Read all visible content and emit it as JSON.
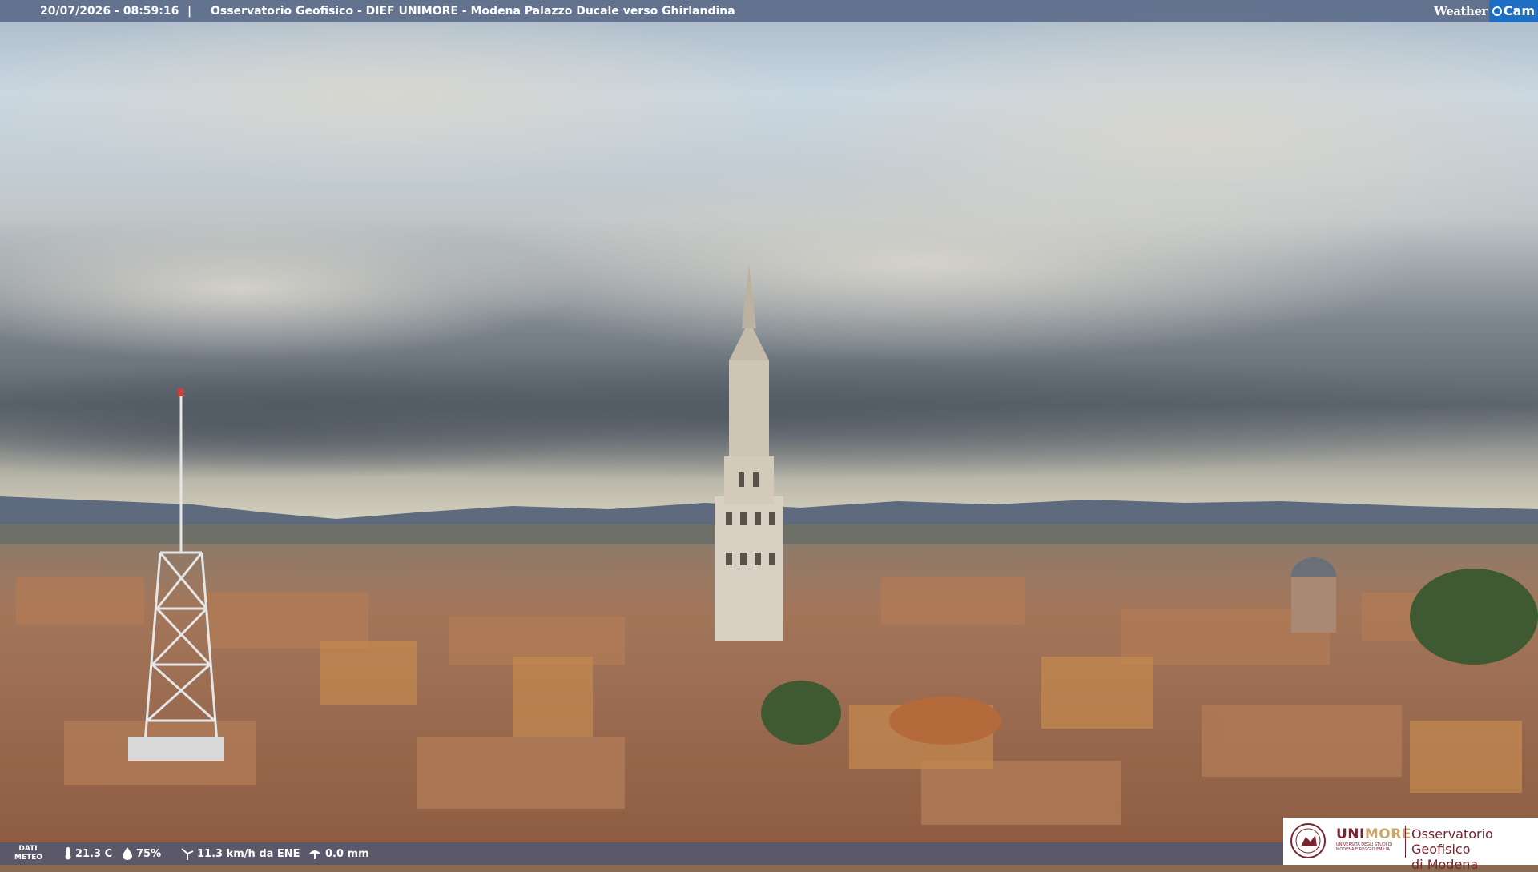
{
  "header": {
    "datetime": "20/07/2026 - 08:59:16",
    "separator": "|",
    "location": "Osservatorio Geofisico - DIEF UNIMORE - Modena Palazzo Ducale verso Ghirlandina",
    "brand_weather": "Weather",
    "brand_cam": "Cam"
  },
  "weather": {
    "label_line1": "DATI",
    "label_line2": "METEO",
    "temperature": "21.3 C",
    "humidity": "75%",
    "wind": "11.3 km/h da ENE",
    "rain": "0.0 mm"
  },
  "logo": {
    "uni": "UNI",
    "more": "MORE",
    "subtitle": "UNIVERSITÀ DEGLI STUDI DI MODENA E REGGIO EMILIA",
    "observatory_line1": "Osservatorio Geofisico",
    "observatory_line2": "di Modena"
  },
  "colors": {
    "bar": "#465878",
    "brand_blue": "#1e6fc4",
    "unimore_red": "#7a2430",
    "unimore_gold": "#c9a66b"
  }
}
